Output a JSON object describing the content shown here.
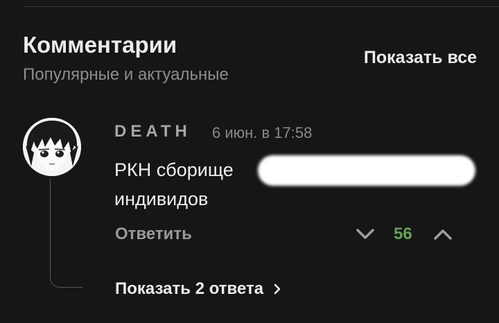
{
  "comments_section": {
    "title": "Комментарии",
    "subtitle": "Популярные и актуальные",
    "show_all_label": "Показать все"
  },
  "comment": {
    "author": "DEATH",
    "timestamp": "6 июн. в 17:58",
    "text_line1": "РКН сборище",
    "text_line2": "индивидов",
    "reply_label": "Ответить",
    "score": "56",
    "show_replies_label": "Показать 2 ответа",
    "icons": {
      "downvote": "chevron-down-icon",
      "upvote": "chevron-up-icon",
      "expand": "chevron-right-icon",
      "avatar": "anime-character-avatar"
    },
    "colors": {
      "score": "#6a9f5a",
      "background": "#161616"
    }
  }
}
